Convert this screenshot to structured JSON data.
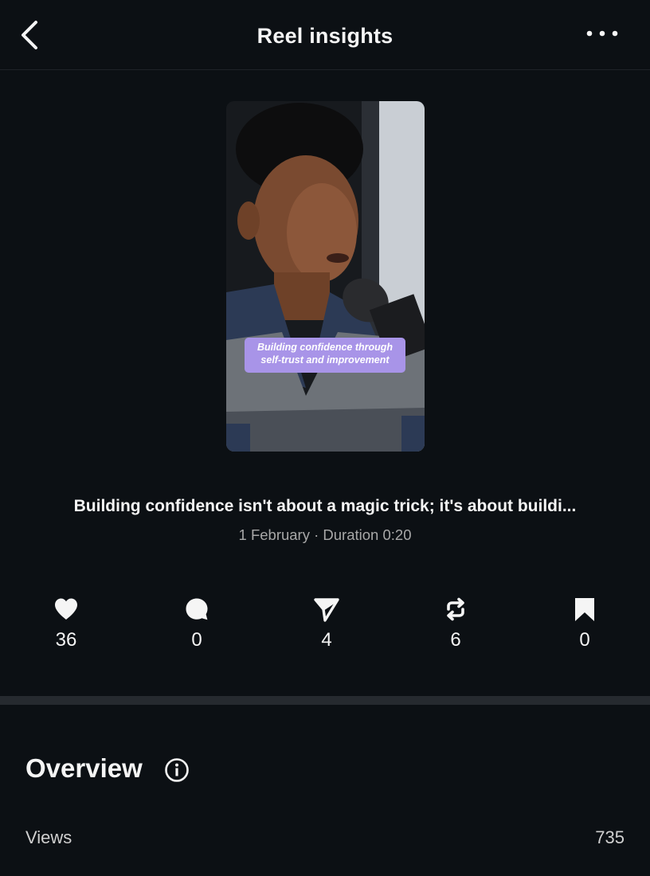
{
  "header": {
    "title": "Reel insights",
    "back_icon": "chevron-left-icon",
    "more_icon": "more-horizontal-icon"
  },
  "reel": {
    "thumbnail_caption": "Building confidence through self-trust and improvement",
    "caption": "Building confidence isn't about a magic trick; it's about buildi...",
    "meta": "1 February · Duration 0:20"
  },
  "stats": [
    {
      "icon": "heart-icon",
      "value": "36"
    },
    {
      "icon": "comment-icon",
      "value": "0"
    },
    {
      "icon": "share-icon",
      "value": "4"
    },
    {
      "icon": "repost-icon",
      "value": "6"
    },
    {
      "icon": "bookmark-icon",
      "value": "0"
    }
  ],
  "overview": {
    "title": "Overview",
    "info_icon": "info-icon",
    "rows": [
      {
        "label": "Views",
        "value": "735"
      }
    ]
  },
  "colors": {
    "background": "#0c1014",
    "caption_highlight": "#a894e8",
    "secondary_text": "#a8a8a8"
  }
}
